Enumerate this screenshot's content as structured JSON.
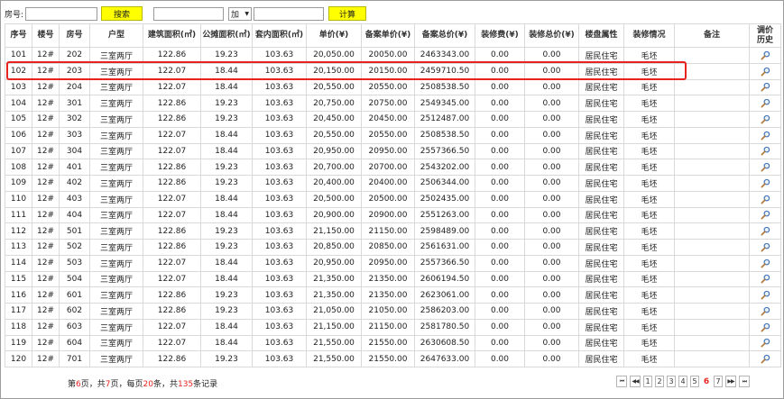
{
  "toolbar": {
    "room_label": "房号:",
    "room_value": "",
    "search_label": "搜索",
    "calc_left_value": "",
    "operator": "加",
    "calc_right_value": "",
    "calc_label": "计算"
  },
  "table": {
    "headers": [
      "序号",
      "楼号",
      "房号",
      "户型",
      "建筑面积(㎡)",
      "公摊面积(㎡)",
      "套内面积(㎡)",
      "单价(¥)",
      "备案单价(¥)",
      "备案总价(¥)",
      "装修费(¥)",
      "装修总价(¥)",
      "楼盘属性",
      "装修情况",
      "备注",
      "调价\n历史"
    ],
    "rows": [
      [
        "101",
        "12#",
        "202",
        "三室两厅",
        "122.86",
        "19.23",
        "103.63",
        "20,050.00",
        "20050.00",
        "2463343.00",
        "0.00",
        "0.00",
        "居民住宅",
        "毛坯",
        ""
      ],
      [
        "102",
        "12#",
        "203",
        "三室两厅",
        "122.07",
        "18.44",
        "103.63",
        "20,150.00",
        "20150.00",
        "2459710.50",
        "0.00",
        "0.00",
        "居民住宅",
        "毛坯",
        ""
      ],
      [
        "103",
        "12#",
        "204",
        "三室两厅",
        "122.07",
        "18.44",
        "103.63",
        "20,550.00",
        "20550.00",
        "2508538.50",
        "0.00",
        "0.00",
        "居民住宅",
        "毛坯",
        ""
      ],
      [
        "104",
        "12#",
        "301",
        "三室两厅",
        "122.86",
        "19.23",
        "103.63",
        "20,750.00",
        "20750.00",
        "2549345.00",
        "0.00",
        "0.00",
        "居民住宅",
        "毛坯",
        ""
      ],
      [
        "105",
        "12#",
        "302",
        "三室两厅",
        "122.86",
        "19.23",
        "103.63",
        "20,450.00",
        "20450.00",
        "2512487.00",
        "0.00",
        "0.00",
        "居民住宅",
        "毛坯",
        ""
      ],
      [
        "106",
        "12#",
        "303",
        "三室两厅",
        "122.07",
        "18.44",
        "103.63",
        "20,550.00",
        "20550.00",
        "2508538.50",
        "0.00",
        "0.00",
        "居民住宅",
        "毛坯",
        ""
      ],
      [
        "107",
        "12#",
        "304",
        "三室两厅",
        "122.07",
        "18.44",
        "103.63",
        "20,950.00",
        "20950.00",
        "2557366.50",
        "0.00",
        "0.00",
        "居民住宅",
        "毛坯",
        ""
      ],
      [
        "108",
        "12#",
        "401",
        "三室两厅",
        "122.86",
        "19.23",
        "103.63",
        "20,700.00",
        "20700.00",
        "2543202.00",
        "0.00",
        "0.00",
        "居民住宅",
        "毛坯",
        ""
      ],
      [
        "109",
        "12#",
        "402",
        "三室两厅",
        "122.86",
        "19.23",
        "103.63",
        "20,400.00",
        "20400.00",
        "2506344.00",
        "0.00",
        "0.00",
        "居民住宅",
        "毛坯",
        ""
      ],
      [
        "110",
        "12#",
        "403",
        "三室两厅",
        "122.07",
        "18.44",
        "103.63",
        "20,500.00",
        "20500.00",
        "2502435.00",
        "0.00",
        "0.00",
        "居民住宅",
        "毛坯",
        ""
      ],
      [
        "111",
        "12#",
        "404",
        "三室两厅",
        "122.07",
        "18.44",
        "103.63",
        "20,900.00",
        "20900.00",
        "2551263.00",
        "0.00",
        "0.00",
        "居民住宅",
        "毛坯",
        ""
      ],
      [
        "112",
        "12#",
        "501",
        "三室两厅",
        "122.86",
        "19.23",
        "103.63",
        "21,150.00",
        "21150.00",
        "2598489.00",
        "0.00",
        "0.00",
        "居民住宅",
        "毛坯",
        ""
      ],
      [
        "113",
        "12#",
        "502",
        "三室两厅",
        "122.86",
        "19.23",
        "103.63",
        "20,850.00",
        "20850.00",
        "2561631.00",
        "0.00",
        "0.00",
        "居民住宅",
        "毛坯",
        ""
      ],
      [
        "114",
        "12#",
        "503",
        "三室两厅",
        "122.07",
        "18.44",
        "103.63",
        "20,950.00",
        "20950.00",
        "2557366.50",
        "0.00",
        "0.00",
        "居民住宅",
        "毛坯",
        ""
      ],
      [
        "115",
        "12#",
        "504",
        "三室两厅",
        "122.07",
        "18.44",
        "103.63",
        "21,350.00",
        "21350.00",
        "2606194.50",
        "0.00",
        "0.00",
        "居民住宅",
        "毛坯",
        ""
      ],
      [
        "116",
        "12#",
        "601",
        "三室两厅",
        "122.86",
        "19.23",
        "103.63",
        "21,350.00",
        "21350.00",
        "2623061.00",
        "0.00",
        "0.00",
        "居民住宅",
        "毛坯",
        ""
      ],
      [
        "117",
        "12#",
        "602",
        "三室两厅",
        "122.86",
        "19.23",
        "103.63",
        "21,050.00",
        "21050.00",
        "2586203.00",
        "0.00",
        "0.00",
        "居民住宅",
        "毛坯",
        ""
      ],
      [
        "118",
        "12#",
        "603",
        "三室两厅",
        "122.07",
        "18.44",
        "103.63",
        "21,150.00",
        "21150.00",
        "2581780.50",
        "0.00",
        "0.00",
        "居民住宅",
        "毛坯",
        ""
      ],
      [
        "119",
        "12#",
        "604",
        "三室两厅",
        "122.07",
        "18.44",
        "103.63",
        "21,550.00",
        "21550.00",
        "2630608.50",
        "0.00",
        "0.00",
        "居民住宅",
        "毛坯",
        ""
      ],
      [
        "120",
        "12#",
        "701",
        "三室两厅",
        "122.86",
        "19.23",
        "103.63",
        "21,550.00",
        "21550.00",
        "2647633.00",
        "0.00",
        "0.00",
        "居民住宅",
        "毛坯",
        ""
      ]
    ],
    "history_icon": "magnifier-icon",
    "highlighted_row": "102"
  },
  "footer": {
    "page_info": {
      "prefix": "第",
      "current_page": "6",
      "mid1": "页，共",
      "total_pages": "7",
      "mid2": "页，每页",
      "per_page": "20",
      "mid3": "条，共",
      "total_records": "135",
      "suffix": "条记录"
    },
    "pager": {
      "first": "⏮",
      "prev": "◀◀",
      "pages": [
        "1",
        "2",
        "3",
        "4",
        "5",
        "6",
        "7"
      ],
      "current": "6",
      "next": "▶▶",
      "last": "⏭"
    }
  },
  "colors": {
    "button_yellow": "#ffff00",
    "highlight_red": "#e8231f",
    "current_page_red": "#e8231f"
  }
}
